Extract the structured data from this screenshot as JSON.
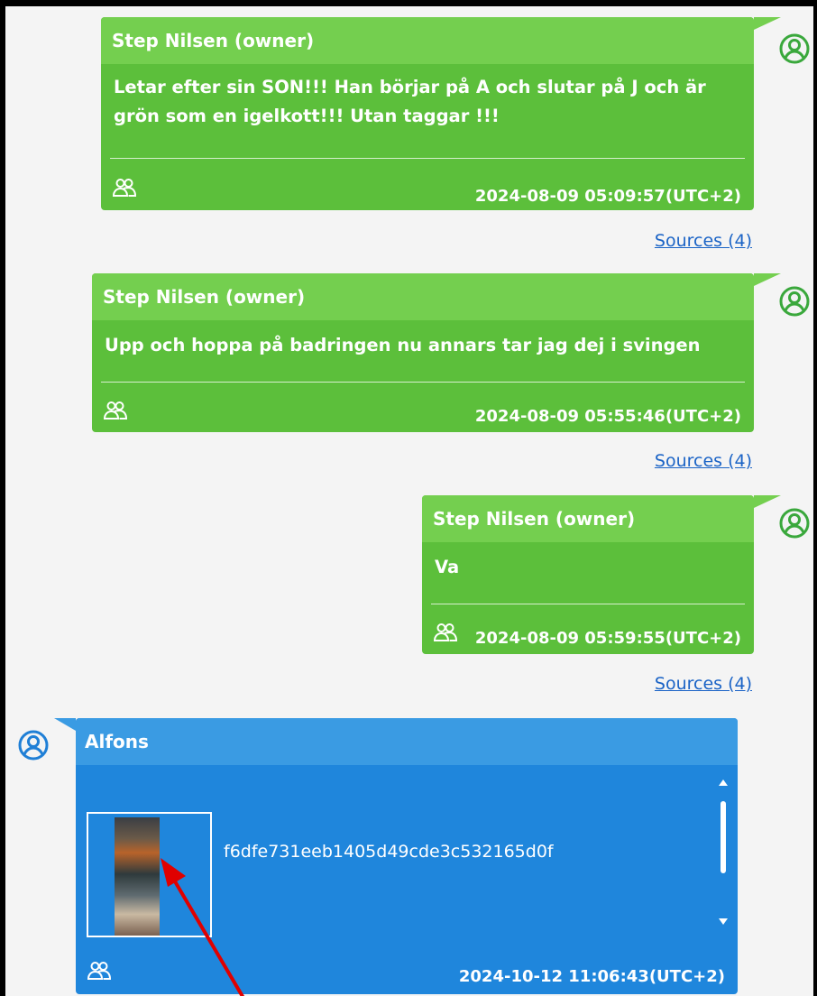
{
  "messages": [
    {
      "sender": "Step Nilsen (owner)",
      "text": "Letar efter sin SON!!! Han börjar på A och slutar på J och är grön som en igelkott!!! Utan taggar !!!",
      "timestamp": "2024-08-09 05:09:57(UTC+2)",
      "sources": "Sources (4)"
    },
    {
      "sender": "Step Nilsen (owner)",
      "text": "Upp och hoppa på badringen nu annars tar jag dej i svingen",
      "timestamp": "2024-08-09 05:55:46(UTC+2)",
      "sources": "Sources (4)"
    },
    {
      "sender": "Step Nilsen (owner)",
      "text": "Va",
      "timestamp": "2024-08-09 05:59:55(UTC+2)",
      "sources": "Sources (4)"
    },
    {
      "sender": "Alfons",
      "attachment_name": "f6dfe731eeb1405d49cde3c532165d0f",
      "timestamp": "2024-10-12 11:06:43(UTC+2)"
    }
  ],
  "colors": {
    "outgoing_bubble": "#5cbf3b",
    "outgoing_header": "#74cf4f",
    "incoming_bubble": "#1f86dc",
    "incoming_header": "#3a9be3",
    "link": "#1a63c6",
    "annotation_arrow": "#e00000"
  },
  "icons": {
    "avatar": "user-circle-icon",
    "group": "group-icon",
    "scroll_up": "triangle-up-icon",
    "scroll_down": "triangle-down-icon"
  }
}
